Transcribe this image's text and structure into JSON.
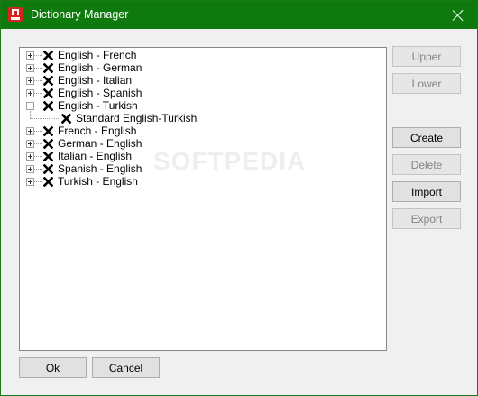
{
  "window": {
    "title": "Dictionary Manager"
  },
  "tree": {
    "items": [
      {
        "label": "English - French"
      },
      {
        "label": "English - German"
      },
      {
        "label": "English - Italian"
      },
      {
        "label": "English - Spanish"
      },
      {
        "label": "English - Turkish",
        "expanded": true,
        "children": [
          {
            "label": "Standard English-Turkish"
          }
        ]
      },
      {
        "label": "French - English"
      },
      {
        "label": "German - English"
      },
      {
        "label": "Italian - English"
      },
      {
        "label": "Spanish - English"
      },
      {
        "label": "Turkish - English"
      }
    ]
  },
  "side_buttons": {
    "upper": "Upper",
    "lower": "Lower",
    "create": "Create",
    "delete": "Delete",
    "import": "Import",
    "export": "Export"
  },
  "bottom_buttons": {
    "ok": "Ok",
    "cancel": "Cancel"
  },
  "watermark": "SOFTPEDIA"
}
